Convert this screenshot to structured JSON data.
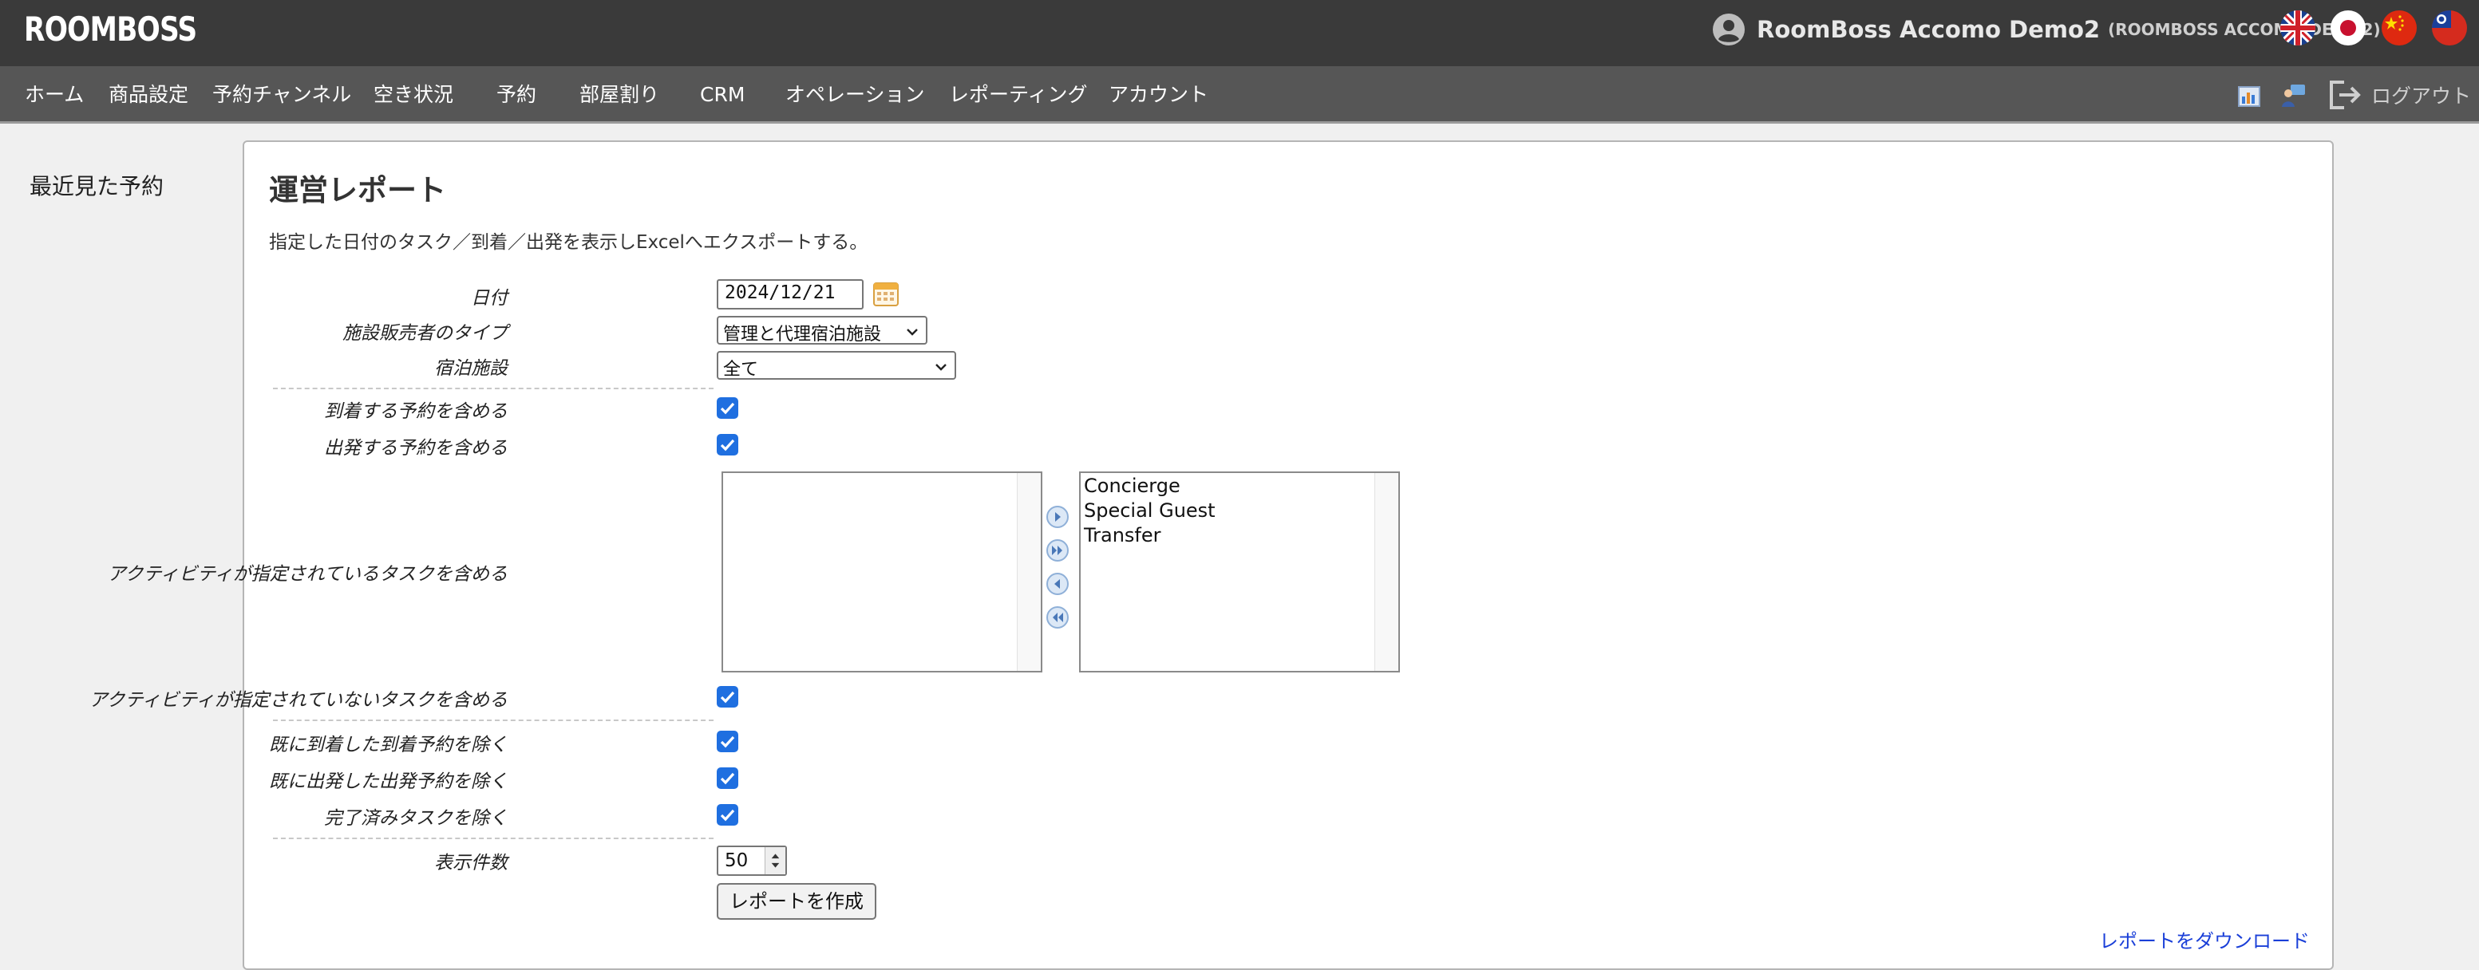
{
  "header": {
    "logo": "ROOMBOSS",
    "account_name": "RoomBoss Accomo Demo2",
    "account_code": "(ROOMBOSS ACCOMO DEMO2)",
    "flags": [
      "uk-flag-icon",
      "japan-flag-icon",
      "china-flag-icon",
      "taiwan-flag-icon"
    ]
  },
  "nav": {
    "items": [
      "ホーム",
      "商品設定",
      "予約チャンネル",
      "空き状況",
      "予約",
      "部屋割り",
      "CRM",
      "オペレーション",
      "レポーティング",
      "アカウント"
    ],
    "logout": "ログアウト"
  },
  "sidebar": {
    "title": "最近見た予約"
  },
  "report": {
    "title": "運営レポート",
    "description": "指定した日付のタスク／到着／出発を表示しExcelへエクスポートする。",
    "date_label": "日付",
    "date_value": "2024/12/21",
    "vendor_type_label": "施設販売者のタイプ",
    "vendor_type_value": "管理と代理宿泊施設",
    "property_label": "宿泊施設",
    "property_value": "全て",
    "include_arrivals_label": "到着する予約を含める",
    "include_departures_label": "出発する予約を含める",
    "activity_tasks_label": "アクティビティが指定されているタスクを含める",
    "selected_activities": [],
    "available_activities": [
      "Concierge",
      "Special Guest",
      "Transfer"
    ],
    "no_activity_tasks_label": "アクティビティが指定されていないタスクを含める",
    "exclude_arrived_label": "既に到着した到着予約を除く",
    "exclude_departed_label": "既に出発した出発予約を除く",
    "exclude_completed_label": "完了済みタスクを除く",
    "rows_label": "表示件数",
    "rows_value": "50",
    "create_button": "レポートを作成",
    "download_link": "レポートをダウンロード"
  },
  "colors": {
    "topbar": "#3a3a3a",
    "navbar": "#565656",
    "checkbox": "#1f6fe0",
    "link": "#1a3fd8"
  }
}
